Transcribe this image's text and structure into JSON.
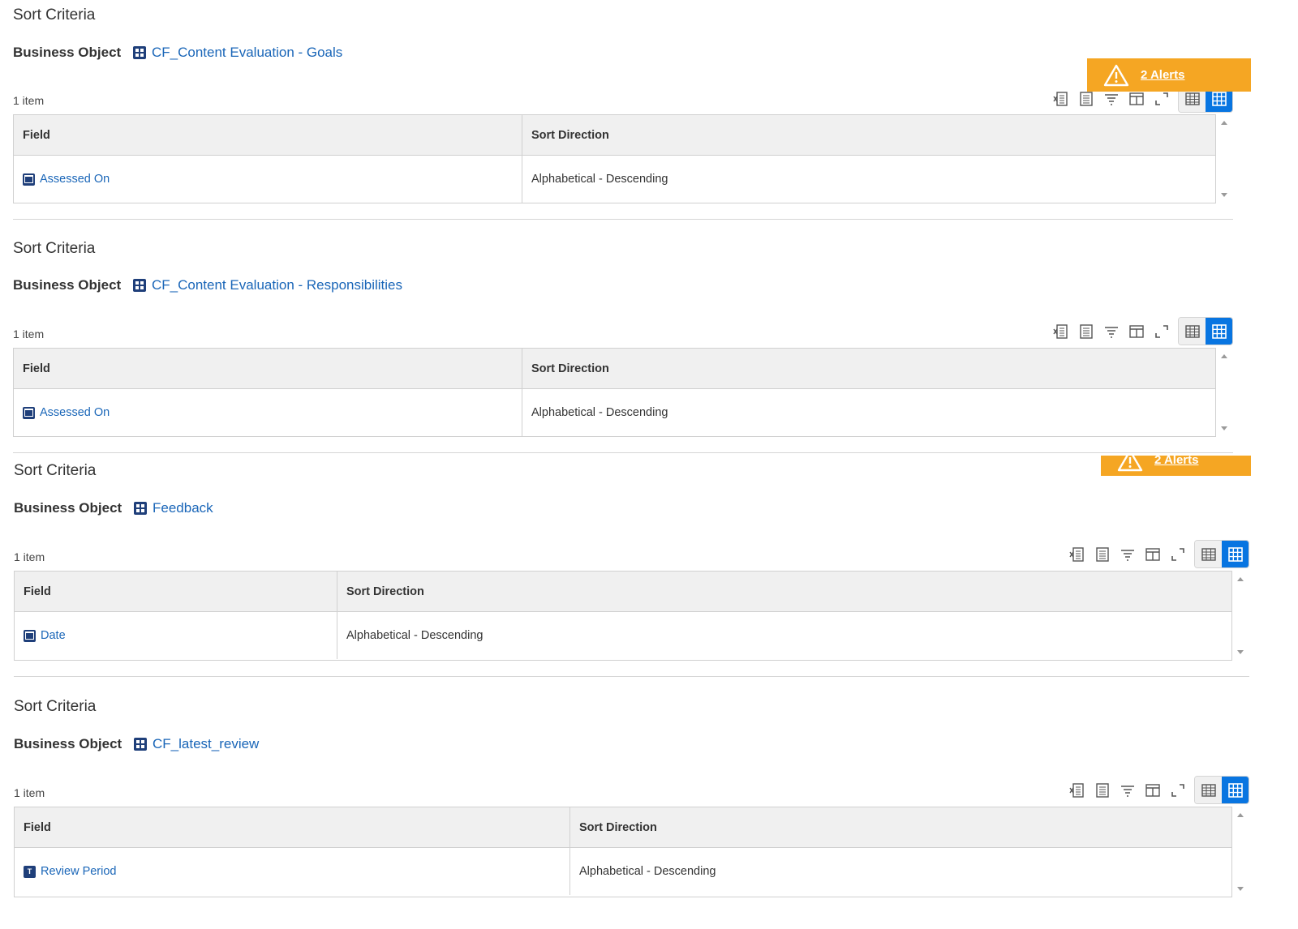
{
  "alerts": {
    "label": "2 Alerts",
    "color": "#f5a623"
  },
  "sections": [
    {
      "title": "Sort Criteria",
      "bo_label": "Business Object",
      "bo_value": "CF_Content Evaluation - Goals",
      "count": "1 item",
      "columns": [
        "Field",
        "Sort Direction"
      ],
      "rows": [
        {
          "field": "Assessed On",
          "field_icon": "calendar-icon",
          "direction": "Alphabetical - Descending"
        }
      ]
    },
    {
      "title": "Sort Criteria",
      "bo_label": "Business Object",
      "bo_value": "CF_Content Evaluation - Responsibilities",
      "count": "1 item",
      "columns": [
        "Field",
        "Sort Direction"
      ],
      "rows": [
        {
          "field": "Assessed On",
          "field_icon": "calendar-icon",
          "direction": "Alphabetical - Descending"
        }
      ]
    },
    {
      "title": "Sort Criteria",
      "bo_label": "Business Object",
      "bo_value": "Feedback",
      "count": "1 item",
      "columns": [
        "Field",
        "Sort Direction"
      ],
      "rows": [
        {
          "field": "Date",
          "field_icon": "calendar-icon",
          "direction": "Alphabetical - Descending"
        }
      ]
    },
    {
      "title": "Sort Criteria",
      "bo_label": "Business Object",
      "bo_value": "CF_latest_review",
      "count": "1 item",
      "columns": [
        "Field",
        "Sort Direction"
      ],
      "rows": [
        {
          "field": "Review Period",
          "field_icon": "text-field-icon",
          "direction": "Alphabetical - Descending"
        }
      ]
    }
  ],
  "toolbar_icons": [
    "excel-export-icon",
    "print-icon",
    "filter-icon",
    "column-layout-icon",
    "fullscreen-icon"
  ],
  "view_toggle": [
    "table-view-icon",
    "grid-view-icon"
  ],
  "accent_color": "#0875e1",
  "link_color": "#1a66b8"
}
